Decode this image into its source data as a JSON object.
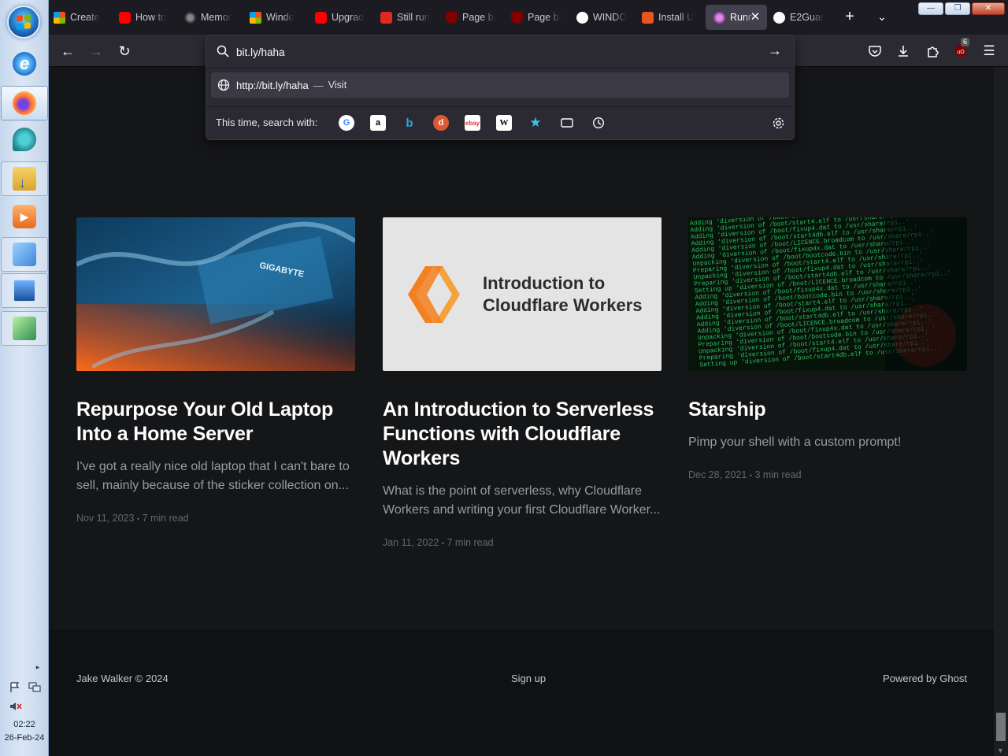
{
  "taskbar": {
    "clock_time": "02:22",
    "clock_date": "26-Feb-24"
  },
  "tabs": [
    {
      "title": "Create",
      "icon": "microsoft-icon"
    },
    {
      "title": "How to",
      "icon": "youtube-icon"
    },
    {
      "title": "Memor",
      "icon": "memory-icon"
    },
    {
      "title": "Windo",
      "icon": "microsoft-icon"
    },
    {
      "title": "Upgrad",
      "icon": "youtube-icon"
    },
    {
      "title": "Still run",
      "icon": "red-c-icon"
    },
    {
      "title": "Page bl",
      "icon": "ublock-icon"
    },
    {
      "title": "Page bl",
      "icon": "ublock-icon"
    },
    {
      "title": "WINDO",
      "icon": "google-icon"
    },
    {
      "title": "Install U",
      "icon": "ubuntu-icon"
    },
    {
      "title": "Runn",
      "icon": "ghost-avatar-icon",
      "selected": true
    },
    {
      "title": "E2Guar",
      "icon": "github-icon"
    }
  ],
  "urlbar": {
    "value": "bit.ly/haha",
    "suggestion_url": "http://bit.ly/haha",
    "suggestion_sep": "—",
    "suggestion_action": "Visit",
    "search_label": "This time, search with:",
    "engines": [
      "google",
      "amazon",
      "bing",
      "duckduckgo",
      "ebay",
      "wikipedia",
      "bookmarks",
      "tabs",
      "history"
    ]
  },
  "toolbar": {
    "ublock_badge": "6"
  },
  "posts": [
    {
      "title": "Repurpose Your Old Laptop Into a Home Server",
      "excerpt": "I've got a really nice old laptop that I can't bare to sell, mainly because of the sticker collection on...",
      "date": "Nov 11, 2023",
      "read": "7 min read"
    },
    {
      "title": "An Introduction to Serverless Functions with Cloudflare Workers",
      "excerpt": "What is the point of serverless, why Cloudflare Workers and writing your first Cloudflare Worker...",
      "date": "Jan 11, 2022",
      "read": "7 min read",
      "image_text": "Introduction to Cloudflare Workers"
    },
    {
      "title": "Starship",
      "excerpt": "Pimp your shell with a custom prompt!",
      "date": "Dec 28, 2021",
      "read": "3 min read"
    }
  ],
  "meta_sep": "•",
  "footer": {
    "copyright": "Jake Walker © 2024",
    "signup": "Sign up",
    "powered": "Powered by Ghost"
  }
}
